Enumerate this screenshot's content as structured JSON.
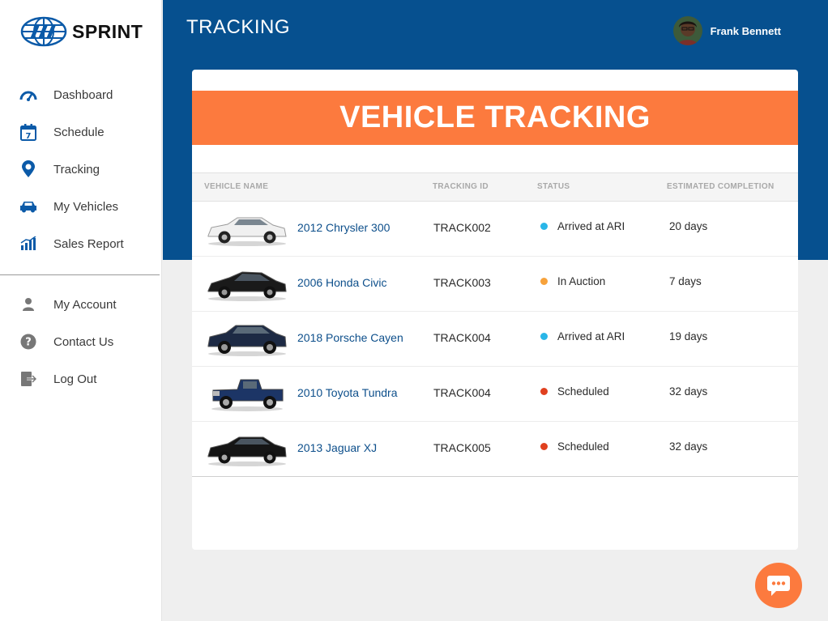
{
  "brand": {
    "name": "SPRINT"
  },
  "sidebar": {
    "main_items": [
      {
        "label": "Dashboard",
        "icon": "gauge-icon"
      },
      {
        "label": "Schedule",
        "icon": "calendar-icon"
      },
      {
        "label": "Tracking",
        "icon": "map-pin-icon"
      },
      {
        "label": "My Vehicles",
        "icon": "car-icon"
      },
      {
        "label": "Sales Report",
        "icon": "bar-chart-icon"
      }
    ],
    "account_items": [
      {
        "label": "My Account",
        "icon": "user-icon"
      },
      {
        "label": "Contact Us",
        "icon": "question-icon"
      },
      {
        "label": "Log Out",
        "icon": "logout-icon"
      }
    ]
  },
  "header": {
    "title": "TRACKING",
    "user_name": "Frank Bennett"
  },
  "main": {
    "banner_title": "VEHICLE TRACKING",
    "columns": [
      "VEHICLE NAME",
      "TRACKING ID",
      "STATUS",
      "ESTIMATED COMPLETION"
    ],
    "rows": [
      {
        "vehicle": "2012 Chrysler 300",
        "tracking_id": "TRACK002",
        "status": "Arrived at ARI",
        "status_color": "#29b6e8",
        "eta": "20 days",
        "car_color": "#f2f2f2"
      },
      {
        "vehicle": "2006 Honda Civic",
        "tracking_id": "TRACK003",
        "status": "In Auction",
        "status_color": "#f7a23b",
        "eta": "7 days",
        "car_color": "#1a1a1a"
      },
      {
        "vehicle": "2018 Porsche Cayen",
        "tracking_id": "TRACK004",
        "status": "Arrived at ARI",
        "status_color": "#29b6e8",
        "eta": "19 days",
        "car_color": "#1d2a44"
      },
      {
        "vehicle": "2010 Toyota Tundra",
        "tracking_id": "TRACK004",
        "status": "Scheduled",
        "status_color": "#e0401f",
        "eta": "32 days",
        "car_color": "#1c3566"
      },
      {
        "vehicle": "2013 Jaguar XJ",
        "tracking_id": "TRACK005",
        "status": "Scheduled",
        "status_color": "#e0401f",
        "eta": "32 days",
        "car_color": "#151515"
      }
    ]
  },
  "colors": {
    "primary": "#06508f",
    "accent": "#fc7a3e",
    "link": "#0d4f8b"
  },
  "chat": {
    "icon": "chat-bubble-icon"
  }
}
